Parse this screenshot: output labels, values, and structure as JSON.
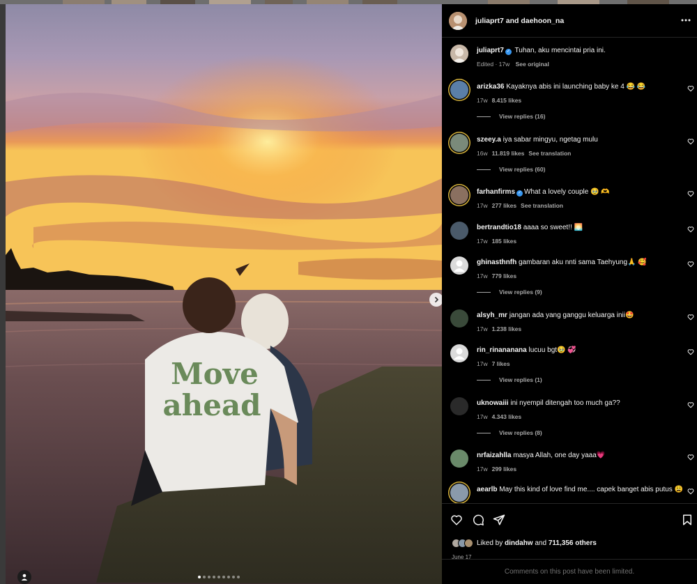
{
  "post": {
    "header_names": "juliaprt7 and daehoon_na",
    "caption": {
      "user": "juliaprt7",
      "verified": true,
      "text": "Tuhan, aku mencintai pria ini.",
      "meta_edited": "Edited · 17w",
      "meta_see_original": "See original"
    },
    "shirt_text_line1": "Move",
    "shirt_text_line2": "ahead",
    "carousel": {
      "total_slides": 9,
      "active_index": 0
    }
  },
  "comments": [
    {
      "user": "arizka36",
      "verified": false,
      "text": "Kayaknya abis ini launching baby ke 4 😂 😂",
      "time": "17w",
      "likes": "8.415 likes",
      "translation": "",
      "replies": "View replies (16)",
      "avatar_color": "#5a7fa8"
    },
    {
      "user": "szeey.a",
      "verified": false,
      "text": "iya sabar mingyu, ngetag mulu",
      "time": "16w",
      "likes": "11.819 likes",
      "translation": "See translation",
      "replies": "View replies (60)",
      "avatar_color": "#7a8a7a"
    },
    {
      "user": "farhanfirms",
      "verified": true,
      "text": "What a lovely couple 🥹 🫶",
      "time": "17w",
      "likes": "277 likes",
      "translation": "See translation",
      "replies": "",
      "avatar_color": "#8a7060"
    },
    {
      "user": "bertrandtio18",
      "verified": false,
      "text": "aaaa so sweet!! 🌅",
      "time": "17w",
      "likes": "185 likes",
      "translation": "",
      "replies": "",
      "avatar_color": "#4a5a6a"
    },
    {
      "user": "ghinasthnfh",
      "verified": false,
      "text": "gambaran aku nnti sama Taehyung🙏 🥰",
      "time": "17w",
      "likes": "779 likes",
      "translation": "",
      "replies": "View replies (9)",
      "avatar_color": "#dbdbdb"
    },
    {
      "user": "alsyh_mr",
      "verified": false,
      "text": "jangan ada yang ganggu keluarga inii🤩",
      "time": "17w",
      "likes": "1.238 likes",
      "translation": "",
      "replies": "",
      "avatar_color": "#3a4a3a"
    },
    {
      "user": "rin_rinananana",
      "verified": false,
      "text": "lucuu bgt🥹 💞",
      "time": "17w",
      "likes": "7 likes",
      "translation": "",
      "replies": "View replies (1)",
      "avatar_color": "#dbdbdb"
    },
    {
      "user": "uknowaiii",
      "verified": false,
      "text": "ini nyempil ditengah too much ga??",
      "time": "17w",
      "likes": "4.343 likes",
      "translation": "",
      "replies": "View replies (8)",
      "avatar_color": "#2a2a2a"
    },
    {
      "user": "nrfaizahlla",
      "verified": false,
      "text": "masya Allah, one day yaaa💗",
      "time": "17w",
      "likes": "299 likes",
      "translation": "",
      "replies": "",
      "avatar_color": "#6a8a6a"
    },
    {
      "user": "aearlb",
      "verified": false,
      "text": "May this kind of love find me.... capek banget abis putus 😩",
      "time": "",
      "likes": "",
      "translation": "",
      "replies": "",
      "avatar_color": "#8a9aaa"
    }
  ],
  "footer": {
    "liked_prefix": "Liked by ",
    "liked_user": "dindahw",
    "liked_and": " and ",
    "liked_others": "711,356 others",
    "date": "June 17",
    "limited_notice": "Comments on this post have been limited."
  }
}
